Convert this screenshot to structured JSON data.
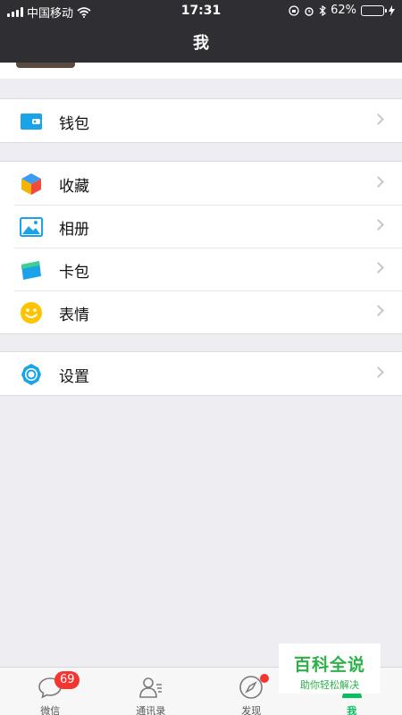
{
  "status_bar": {
    "carrier": "中国移动",
    "time": "17:31",
    "battery_percent": "62%",
    "battery_level": 0.62
  },
  "nav": {
    "title": "我"
  },
  "menu": {
    "wallet": {
      "label": "钱包",
      "icon": "wallet-icon"
    },
    "favorites": {
      "label": "收藏",
      "icon": "cube-icon"
    },
    "album": {
      "label": "相册",
      "icon": "image-icon"
    },
    "cards": {
      "label": "卡包",
      "icon": "card-icon"
    },
    "stickers": {
      "label": "表情",
      "icon": "smile-icon"
    },
    "settings": {
      "label": "设置",
      "icon": "gear-icon"
    }
  },
  "tabbar": {
    "chats": {
      "label": "微信",
      "badge": "69"
    },
    "contacts": {
      "label": "通讯录"
    },
    "discover": {
      "label": "发现"
    },
    "me": {
      "label": "我"
    }
  },
  "watermark": {
    "title": "百科全说",
    "subtitle": "助你轻松解决"
  },
  "colors": {
    "accent": "#07c160",
    "header_bg": "#2e2e33",
    "badge": "#f43530",
    "wallet": "#1aa3e8"
  }
}
